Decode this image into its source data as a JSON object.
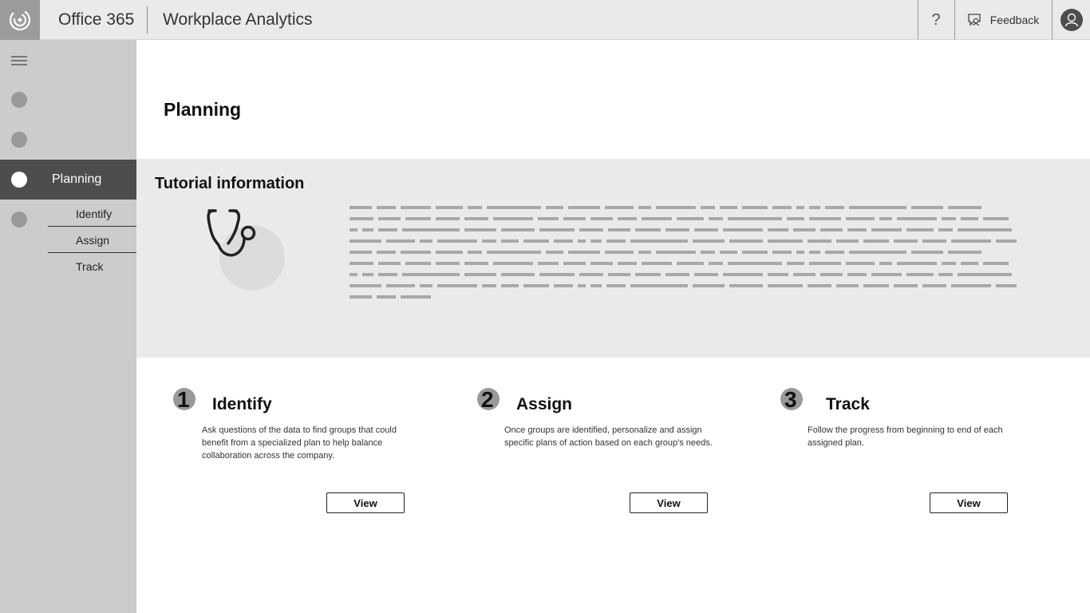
{
  "header": {
    "app_name": "Office 365",
    "product_name": "Workplace Analytics",
    "help_label": "?",
    "feedback_label": "Feedback"
  },
  "sidebar": {
    "active_item": "Planning",
    "sub_items": [
      "Identify",
      "Assign",
      "Track"
    ]
  },
  "page": {
    "title": "Planning"
  },
  "tutorial": {
    "title": "Tutorial information",
    "icon": "stethoscope-icon"
  },
  "steps": [
    {
      "number": "1",
      "title": "Identify",
      "description": "Ask questions of the data to find groups that could benefit from a specialized plan to help balance collaboration across the company.",
      "button_label": "View"
    },
    {
      "number": "2",
      "title": "Assign",
      "description": "Once groups are identified, personalize and assign specific plans of action based on each group's needs.",
      "button_label": "View"
    },
    {
      "number": "3",
      "title": "Track",
      "description": "Follow the progress from beginning to end of each assigned plan.",
      "button_label": "View"
    }
  ],
  "colors": {
    "sidebar_bg": "#cccccc",
    "active_nav_bg": "#4d4d4d",
    "header_bg": "#eaeaea",
    "panel_bg": "#eaeaea"
  }
}
